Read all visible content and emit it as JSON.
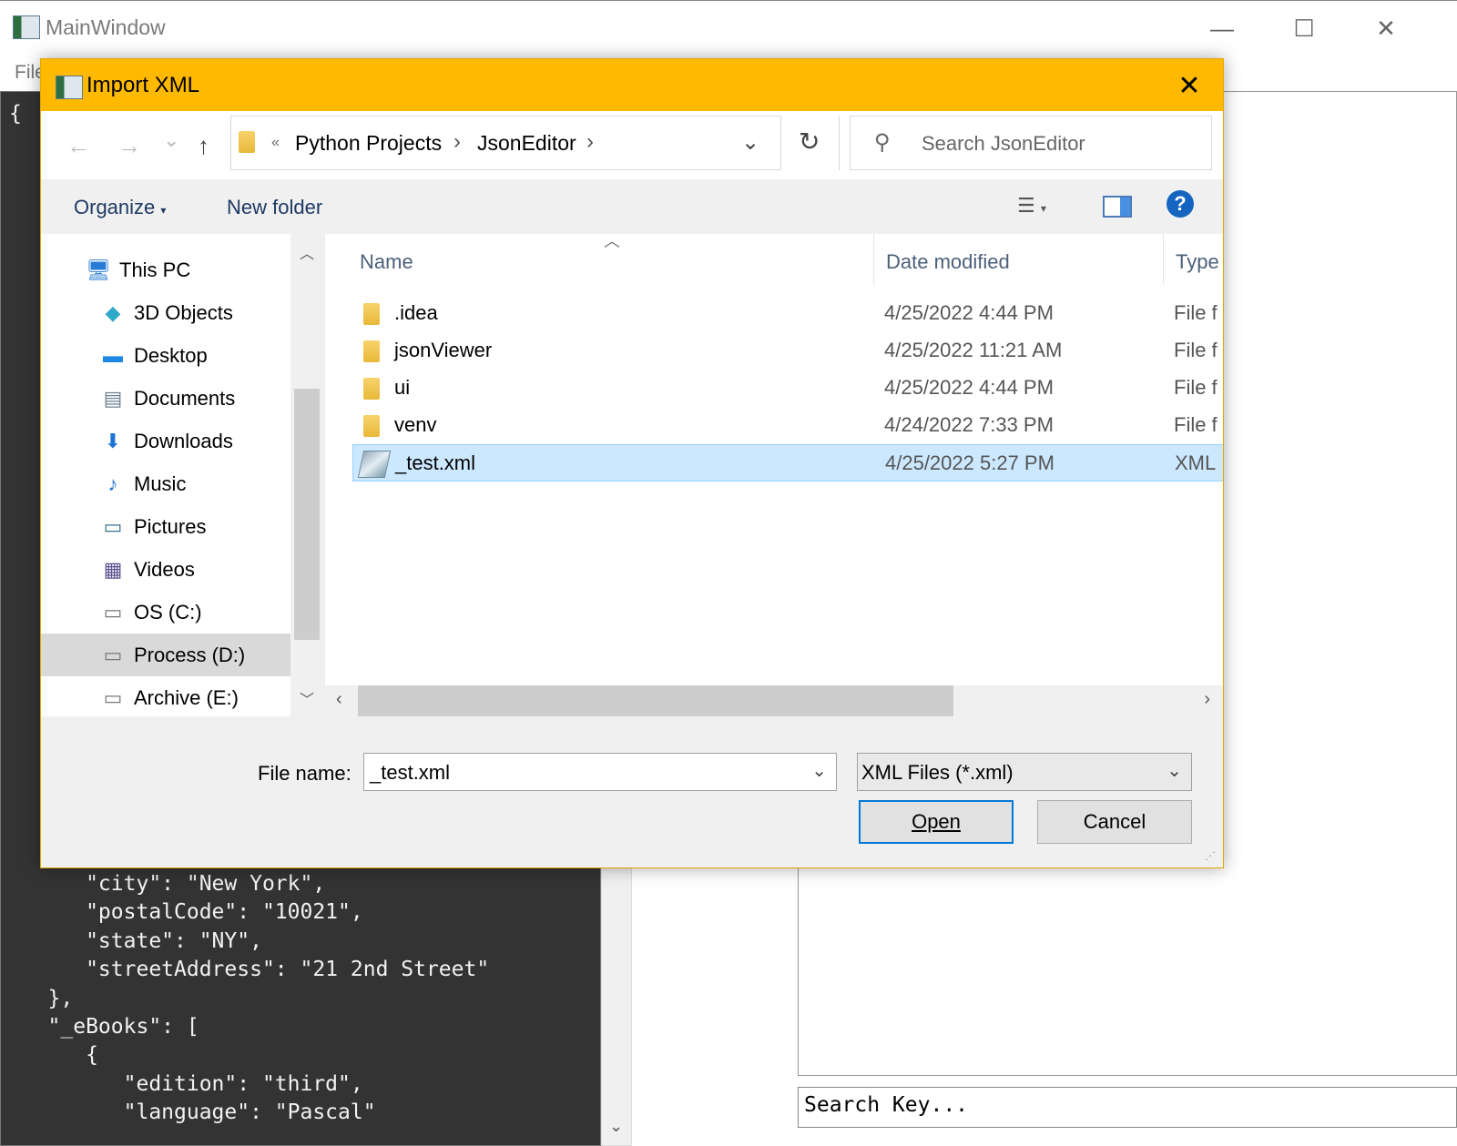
{
  "main_window": {
    "title": "MainWindow",
    "controls": {
      "minimize": "—",
      "maximize": "☐",
      "close": "✕"
    },
    "menu": {
      "file": "File"
    },
    "editor": {
      "open_brace": "{",
      "lines": [
        "      \"city\": \"New York\",",
        "      \"postalCode\": \"10021\",",
        "      \"state\": \"NY\",",
        "      \"streetAddress\": \"21 2nd Street\"",
        "   },",
        "   \"_eBooks\": [",
        "      {",
        "         \"edition\": \"third\",",
        "         \"language\": \"Pascal\""
      ]
    },
    "search_key_placeholder": "Search Key..."
  },
  "dialog": {
    "title": "Import XML",
    "close": "✕",
    "nav": {
      "back": "←",
      "forward": "→",
      "recent": "⌄",
      "up": "↑",
      "refresh": "↻"
    },
    "breadcrumb": {
      "overflow": "«",
      "items": [
        "Python Projects",
        "JsonEditor"
      ],
      "sep": "›"
    },
    "search_placeholder": "Search JsonEditor",
    "toolbar": {
      "organize": "Organize",
      "new_folder": "New folder",
      "help": "?"
    },
    "nav_pane": [
      {
        "label": "This PC",
        "icon": "computer-icon"
      },
      {
        "label": "3D Objects",
        "icon": "cube-icon"
      },
      {
        "label": "Desktop",
        "icon": "desktop-icon"
      },
      {
        "label": "Documents",
        "icon": "document-icon"
      },
      {
        "label": "Downloads",
        "icon": "download-icon"
      },
      {
        "label": "Music",
        "icon": "music-icon"
      },
      {
        "label": "Pictures",
        "icon": "picture-icon"
      },
      {
        "label": "Videos",
        "icon": "video-icon"
      },
      {
        "label": "OS (C:)",
        "icon": "os-drive-icon"
      },
      {
        "label": "Process (D:)",
        "icon": "drive-icon"
      },
      {
        "label": "Archive (E:)",
        "icon": "drive-icon"
      }
    ],
    "columns": {
      "name": "Name",
      "date": "Date modified",
      "type": "Type"
    },
    "files": [
      {
        "name": ".idea",
        "date": "4/25/2022 4:44 PM",
        "type": "File f",
        "kind": "folder"
      },
      {
        "name": "jsonViewer",
        "date": "4/25/2022 11:21 AM",
        "type": "File f",
        "kind": "folder"
      },
      {
        "name": "ui",
        "date": "4/25/2022 4:44 PM",
        "type": "File f",
        "kind": "folder"
      },
      {
        "name": "venv",
        "date": "4/24/2022 7:33 PM",
        "type": "File f",
        "kind": "folder"
      },
      {
        "name": "_test.xml",
        "date": "4/25/2022 5:27 PM",
        "type": "XML",
        "kind": "xml"
      }
    ],
    "file_name_label": "File name:",
    "file_name_value": "_test.xml",
    "file_type_value": "XML Files (*.xml)",
    "open_label": "Open",
    "cancel_label": "Cancel"
  }
}
